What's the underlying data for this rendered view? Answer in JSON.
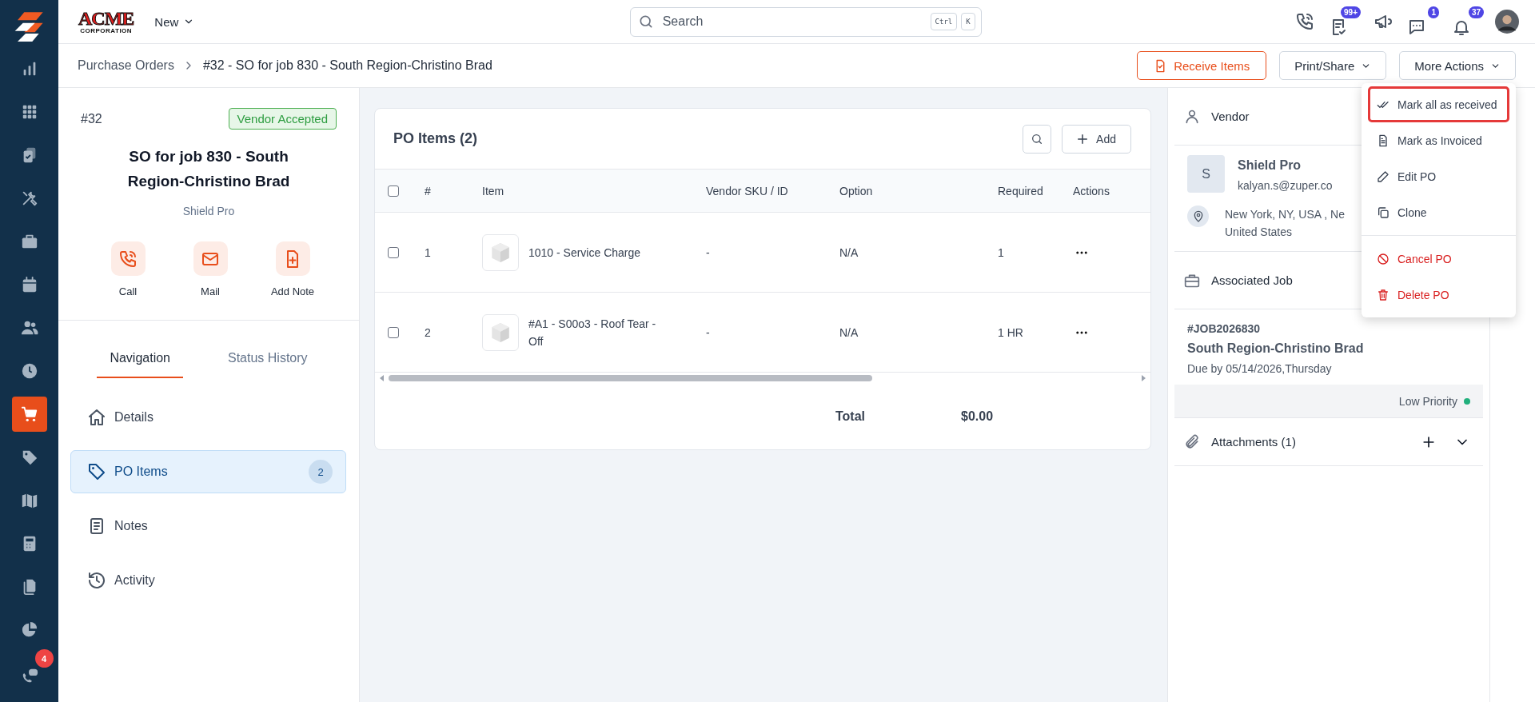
{
  "sidebar": {
    "items": [
      {
        "selected": false
      },
      {
        "selected": false
      },
      {
        "selected": false
      },
      {
        "selected": false
      },
      {
        "selected": false
      },
      {
        "selected": false
      },
      {
        "selected": false
      },
      {
        "selected": false
      },
      {
        "selected": true
      },
      {
        "selected": false
      },
      {
        "selected": false
      },
      {
        "selected": false
      },
      {
        "selected": false
      },
      {
        "selected": false
      },
      {
        "selected": false
      }
    ],
    "chat_badge": "4"
  },
  "topbar": {
    "logo": {
      "title": "ACME",
      "subtitle": "CORPORATION"
    },
    "new_menu": "New",
    "search": {
      "placeholder": "Search",
      "shortcut": [
        "Ctrl",
        "K"
      ]
    },
    "tasks_badge": "99+",
    "messages_badge": "1",
    "notifications_badge": "37"
  },
  "breadcrumb": [
    "Purchase Orders",
    "#32 - SO for job 830 - South Region-Christino Brad"
  ],
  "actions": [
    {
      "label": "Receive Items",
      "kind": "primary"
    },
    {
      "label": "Print/Share",
      "kind": "menu"
    },
    {
      "label": "More Actions",
      "kind": "menu"
    }
  ],
  "summary": {
    "number": "#32",
    "status": "Vendor Accepted",
    "title": "SO for job 830 - South Region-Christino Brad",
    "vendor": "Shield Pro",
    "quick_actions": [
      "Call",
      "Mail",
      "Add Note"
    ]
  },
  "tabs": [
    {
      "label": "Navigation",
      "selected": true
    },
    {
      "label": "Status History",
      "selected": false
    }
  ],
  "nav": [
    {
      "label": "Details",
      "selected": false
    },
    {
      "label": "PO Items",
      "selected": true,
      "count": "2"
    },
    {
      "label": "Notes",
      "selected": false
    },
    {
      "label": "Activity",
      "selected": false
    }
  ],
  "po_items": {
    "title": "PO Items (2)",
    "add_button": "Add",
    "header_checked": false,
    "columns": [
      "#",
      "Item",
      "Vendor SKU / ID",
      "Option",
      "Required",
      "Actions"
    ],
    "rows": [
      {
        "checked": false,
        "number": "1",
        "item": "1010 - Service Charge",
        "vendor_sku": "-",
        "option": "N/A",
        "required": "1"
      },
      {
        "checked": false,
        "number": "2",
        "item": "#A1 - S00o3 - Roof Tear -Off",
        "vendor_sku": "-",
        "option": "N/A",
        "required": "1 HR"
      }
    ],
    "total_label": "Total",
    "total": "$0.00"
  },
  "vendor": {
    "heading": "Vendor",
    "initial": "S",
    "name": "Shield Pro",
    "email": "kalyan.s@zuper.co",
    "address": [
      "New York, NY, USA , Ne",
      "United States"
    ]
  },
  "job": {
    "heading": "Associated Job",
    "number": "#JOB2026830",
    "name": "South Region-Christino Brad",
    "due": "Due by 05/14/2026,Thursday",
    "priority": {
      "label": "Low Priority",
      "color": "#22b07d"
    }
  },
  "attachments": {
    "heading": "Attachments (1)",
    "expanded": false
  },
  "menu": {
    "items": [
      {
        "label": "Mark all as received",
        "kind": "normal",
        "selected": true
      },
      {
        "label": "Mark as Invoiced",
        "kind": "normal",
        "selected": false
      },
      {
        "label": "Edit PO",
        "kind": "normal",
        "selected": false
      },
      {
        "label": "Clone",
        "kind": "normal",
        "selected": false
      },
      {
        "label": "Cancel PO",
        "kind": "danger",
        "selected": false
      },
      {
        "label": "Delete PO",
        "kind": "danger",
        "selected": false
      }
    ]
  }
}
